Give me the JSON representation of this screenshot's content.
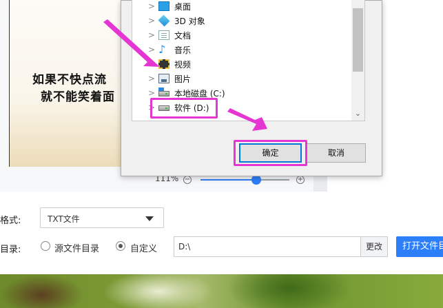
{
  "preview": {
    "line1": "如果不快点流",
    "line2": "就不能笑着面"
  },
  "zoom": {
    "percent": "111%",
    "minus": "⊖",
    "plus": "⊕",
    "level": 0.63
  },
  "dialog": {
    "tree": [
      {
        "chevron": ">",
        "icon": "desktop-icon",
        "label": "桌面"
      },
      {
        "chevron": ">",
        "icon": "3d-objects-icon",
        "label": "3D 对象"
      },
      {
        "chevron": ">",
        "icon": "documents-icon",
        "label": "文档"
      },
      {
        "chevron": ">",
        "icon": "music-icon",
        "label": "音乐"
      },
      {
        "chevron": ">",
        "icon": "videos-icon",
        "label": "视频"
      },
      {
        "chevron": ">",
        "icon": "pictures-icon",
        "label": "图片"
      },
      {
        "chevron": ">",
        "icon": "local-disk-icon",
        "label": "本地磁盘 (C:)"
      },
      {
        "chevron": ">",
        "icon": "disk-icon",
        "label": "软件 (D:)"
      }
    ],
    "ok_label": "确定",
    "cancel_label": "取消",
    "scroll_down": "⌄"
  },
  "settings": {
    "format_label": "格式:",
    "format_value": "TXT文件",
    "dir_label": "目录:",
    "radio_source": "源文件目录",
    "radio_custom": "自定义",
    "selected_radio": "自定义",
    "path_value": "D:\\",
    "change_label": "更改",
    "open_label": "打开文件目"
  },
  "colors": {
    "accent": "#2d7ff9",
    "highlight": "#e535d3",
    "dialog_focus": "#0078d7"
  }
}
